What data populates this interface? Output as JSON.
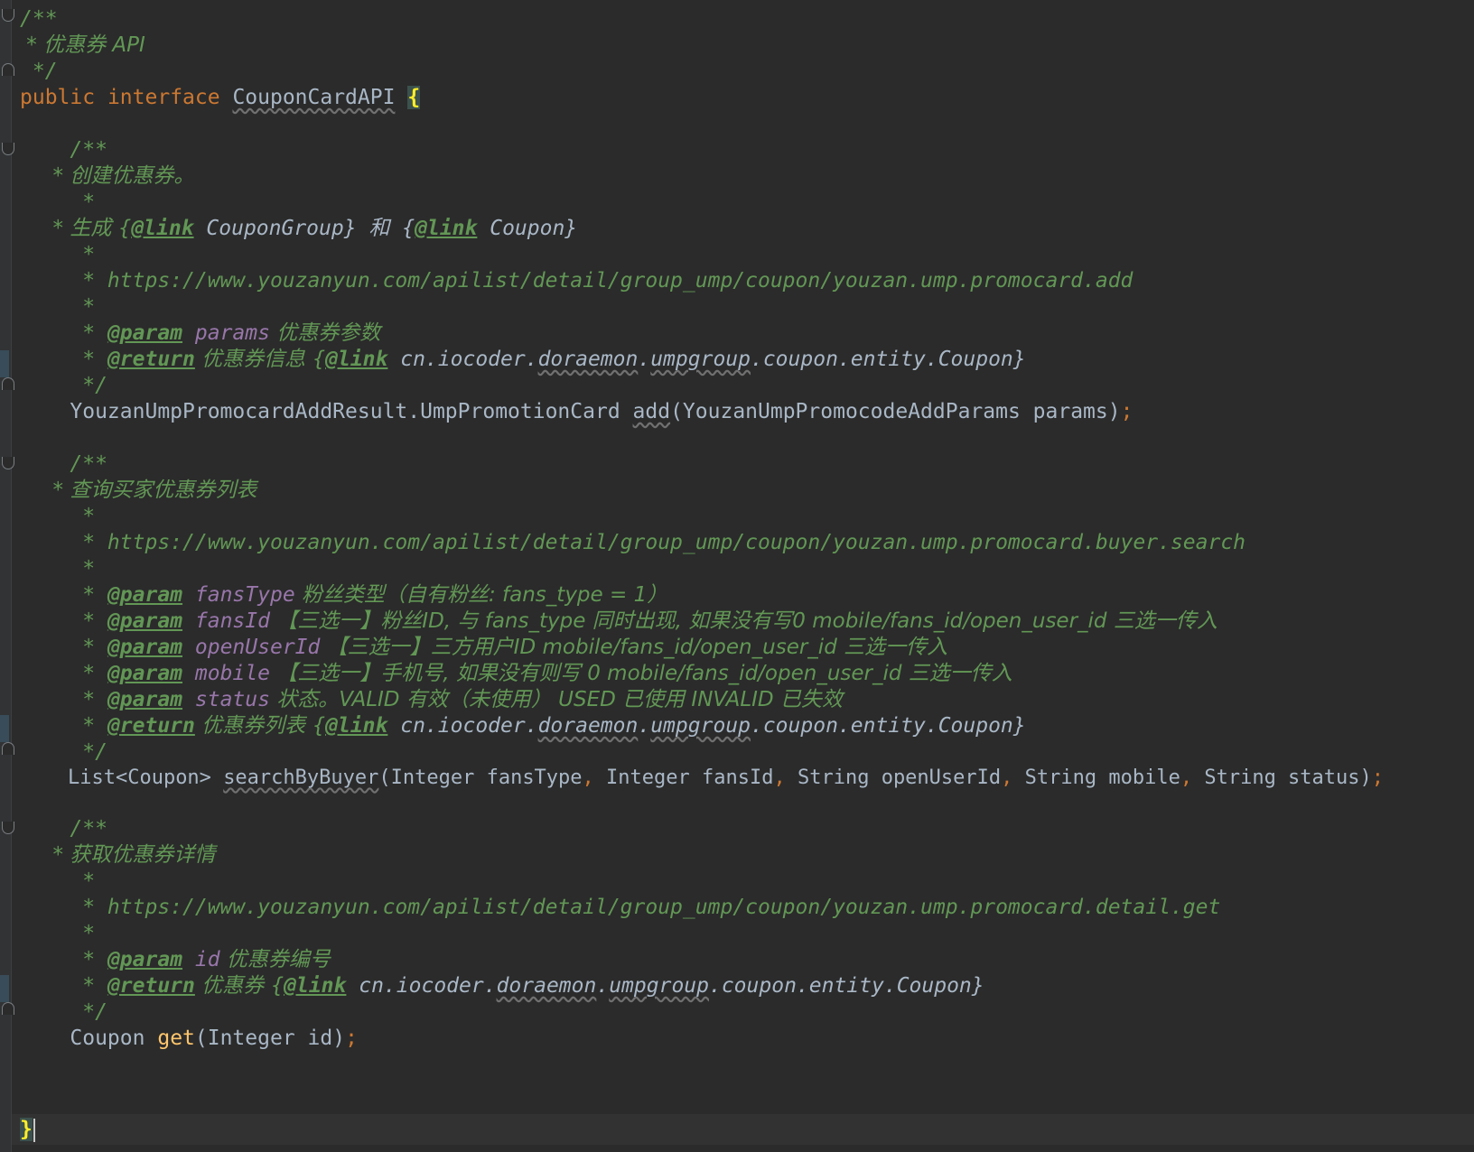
{
  "editor": {
    "file_header": {
      "open": "/**",
      "title": " * 优惠券 API",
      "close": " */"
    },
    "interface_decl": {
      "modifier": "public",
      "keyword": "interface",
      "name": "CouponCardAPI",
      "brace": "{"
    },
    "add_doc": {
      "open": "    /**",
      "desc": "     * 创建优惠券。",
      "blank": "     *",
      "gen_prefix": "     * 生成 {",
      "link_tag": "@link",
      "gen_mid": " CouponGroup} 和 {",
      "gen_end": " Coupon}",
      "url": "     * https://www.youzanyun.com/apilist/detail/group_ump/coupon/youzan.ump.promocard.add",
      "param_tag": "@param",
      "param_name": "params",
      "param_desc": " 优惠券参数",
      "return_tag": "@return",
      "return_desc": " 优惠券信息 {",
      "return_link": "@link",
      "return_pkg": " cn.iocoder.",
      "return_p1": "doraemon",
      "return_p2": "umpgroup",
      "return_tail": ".coupon.entity.Coupon}",
      "close": "     */"
    },
    "add_method": {
      "return_type": "YouzanUmpPromocardAddResult.UmpPromotionCard",
      "name": "add",
      "params": "(YouzanUmpPromocodeAddParams params)",
      "semi": ";"
    },
    "search_doc": {
      "open": "    /**",
      "desc": "     * 查询买家优惠券列表",
      "url": "     * https://www.youzanyun.com/apilist/detail/group_ump/coupon/youzan.ump.promocard.buyer.search",
      "p1_name": "fansType",
      "p1_desc": " 粉丝类型（自有粉丝: fans_type = 1）",
      "p2_name": "fansId",
      "p2_desc": " 【三选一】粉丝ID, 与 fans_type 同时出现, 如果没有写0 mobile/fans_id/open_user_id 三选一传入",
      "p3_name": "openUserId",
      "p3_desc": " 【三选一】三方用户ID mobile/fans_id/open_user_id 三选一传入",
      "p4_name": "mobile",
      "p4_desc": " 【三选一】手机号, 如果没有则写 0 mobile/fans_id/open_user_id 三选一传入",
      "p5_name": "status",
      "p5_desc": " 状态。VALID 有效（未使用） USED 已使用 INVALID 已失效",
      "return_desc": " 优惠券列表 {"
    },
    "search_method": {
      "return_type": "List<Coupon>",
      "name": "searchByBuyer",
      "a1": "(Integer fansType",
      "a2": " Integer fansId",
      "a3": " String openUserId",
      "a4": " String mobile",
      "a5": " String status)",
      "comma": ",",
      "semi": ";"
    },
    "get_doc": {
      "desc": "     * 获取优惠券详情",
      "url": "     * https://www.youzanyun.com/apilist/detail/group_ump/coupon/youzan.ump.promocard.detail.get",
      "param_name": "id",
      "param_desc": " 优惠券编号",
      "return_desc": " 优惠券 {"
    },
    "get_method": {
      "return_type": "Coupon",
      "name": "get",
      "params": "(Integer id)",
      "semi": ";"
    },
    "closing_brace": "}"
  },
  "colors": {
    "background": "#2b2b2b",
    "comment": "#629755",
    "keyword": "#cc7832",
    "param_name": "#9876aa",
    "method_decl": "#ffc66d",
    "text": "#a9b7c6"
  }
}
